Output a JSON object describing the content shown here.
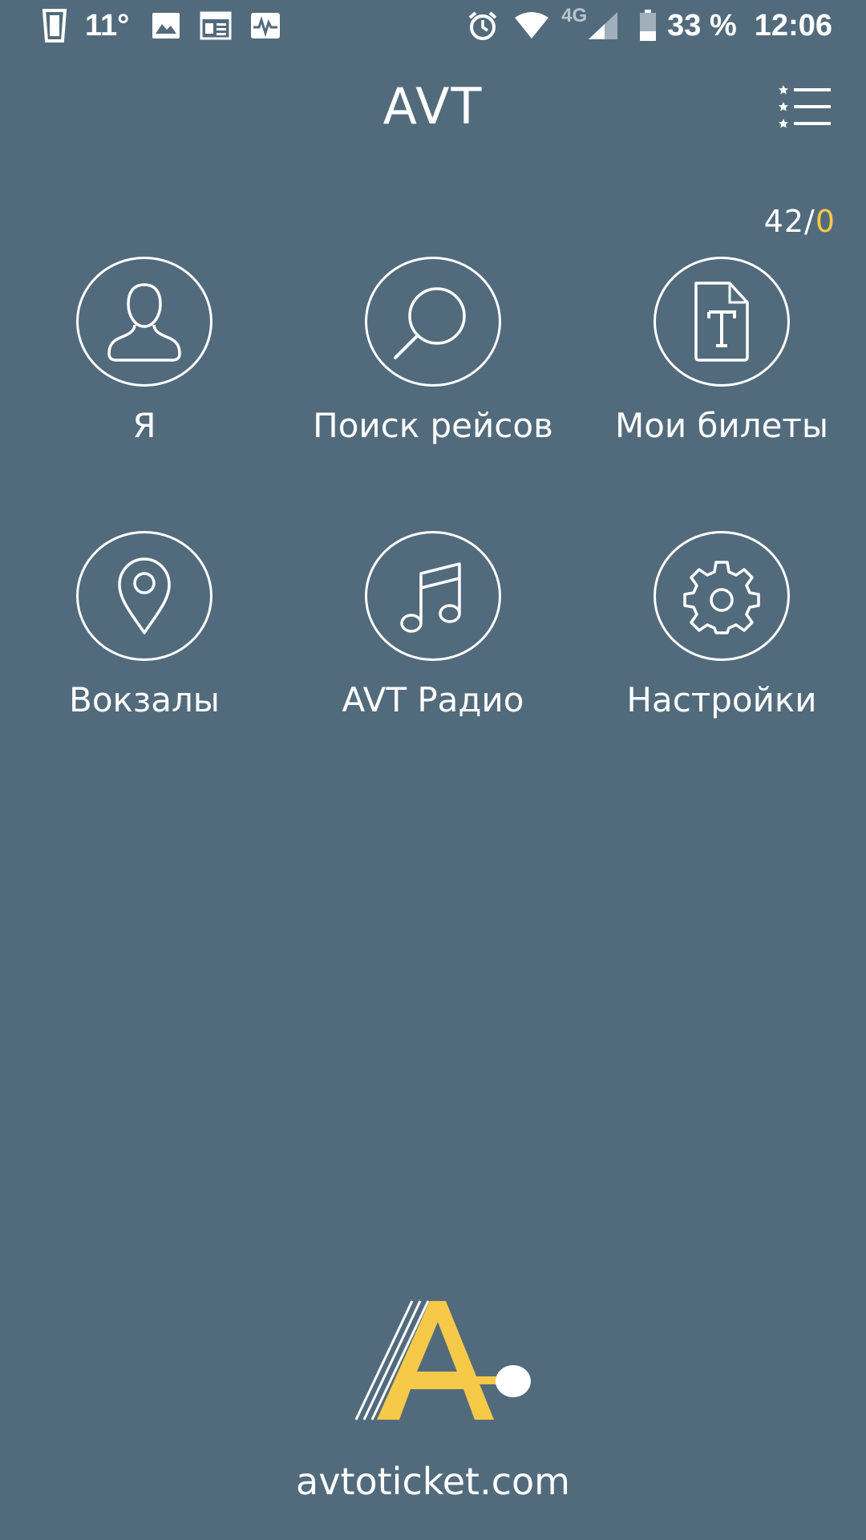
{
  "status_bar": {
    "temperature": "11°",
    "network_type": "4G",
    "battery": "33 %",
    "time": "12:06",
    "icons": [
      "phone-cup-icon",
      "image-icon",
      "news-icon",
      "activity-icon",
      "alarm-icon",
      "wifi-icon",
      "signal-icon",
      "battery-icon"
    ]
  },
  "header": {
    "title": "AVT",
    "menu_icon": "starred-list-icon"
  },
  "counter": {
    "primary": "42/",
    "accent": "0",
    "accent_color": "#f7c948"
  },
  "grid": {
    "items": [
      {
        "label": "Я",
        "icon": "user-icon"
      },
      {
        "label": "Поиск рейсов",
        "icon": "search-icon"
      },
      {
        "label": "Мои билеты",
        "icon": "ticket-icon"
      },
      {
        "label": "Вокзалы",
        "icon": "map-pin-icon"
      },
      {
        "label": "AVT Радио",
        "icon": "music-note-icon"
      },
      {
        "label": "Настройки",
        "icon": "gear-icon"
      }
    ]
  },
  "footer": {
    "logo_icon": "avt-logo-icon",
    "site_url": "avtoticket.com"
  },
  "colors": {
    "background": "#526b7c",
    "foreground": "#ffffff",
    "accent": "#f7c948"
  }
}
